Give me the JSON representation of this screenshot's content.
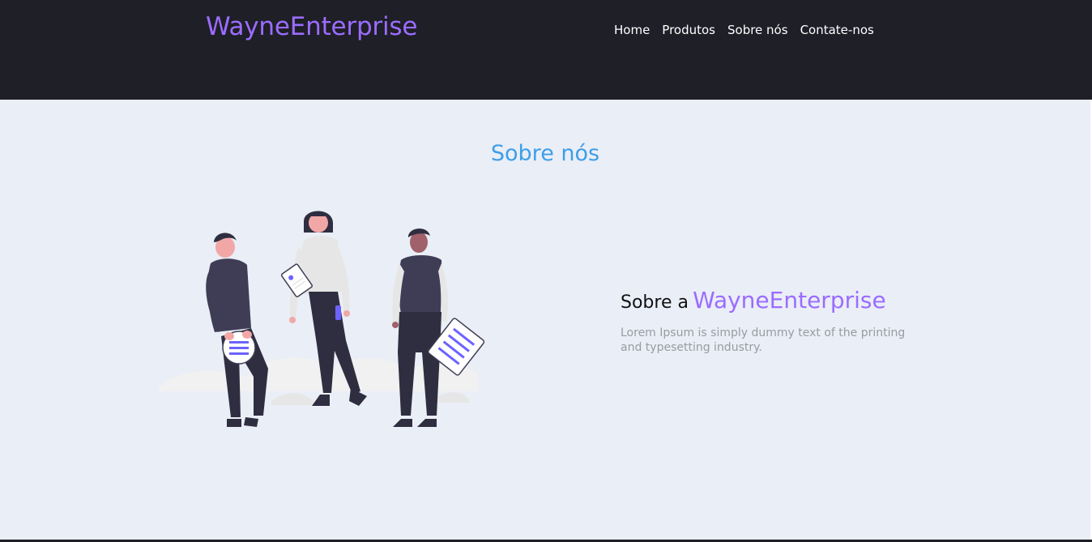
{
  "header": {
    "brand": "WayneEnterprise",
    "nav": [
      {
        "label": "Home"
      },
      {
        "label": "Produtos"
      },
      {
        "label": "Sobre nós"
      },
      {
        "label": "Contate-nos"
      }
    ]
  },
  "about": {
    "section_title": "Sobre nós",
    "heading_prefix": "Sobre a",
    "heading_brand": "WayneEnterprise",
    "description": "Lorem Ipsum is simply dummy text of the printing and typesetting industry."
  },
  "colors": {
    "header_bg": "#1e1f27",
    "brand_accent": "#9b6cff",
    "section_title": "#3e9ee9",
    "content_bg": "#eaeef6",
    "muted_text": "#9a9ba3"
  }
}
